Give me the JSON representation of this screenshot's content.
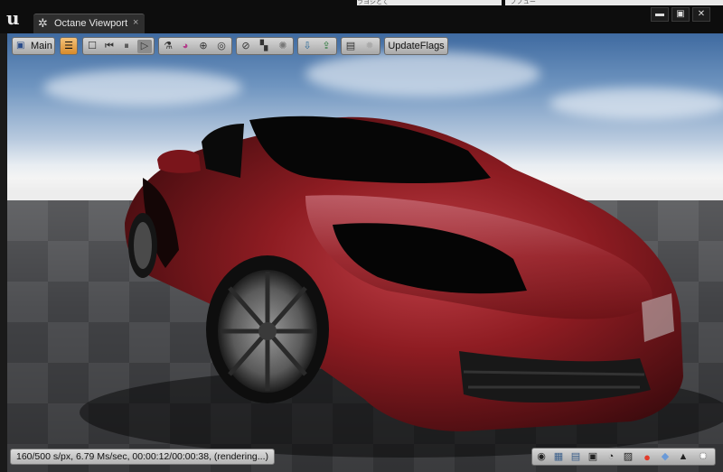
{
  "window": {
    "tab_title": "Octane Viewport",
    "tab_close": "×",
    "app_logo_glyph": "u",
    "minimize_glyph": "▬",
    "maximize_glyph": "▣",
    "close_glyph": "✕",
    "background_text_left": "ラヨシとて",
    "background_text_right": "ノノュー"
  },
  "toolbar": {
    "main_label": "Main",
    "update_flags_label": "UpdateFlags",
    "icons": [
      "settings-icon",
      "stop-icon",
      "restart-icon",
      "pause-icon",
      "play-icon",
      "material-picker-icon",
      "color-icon",
      "object-picker-icon",
      "focus-picker-icon",
      "region-icon",
      "checker-icon",
      "render-passes-icon",
      "import-icon",
      "export-icon",
      "save-image-icon",
      "sun-icon"
    ]
  },
  "status": {
    "text": "160/500 s/px, 6.79 Ms/sec, 00:00:12/00:00:38, (rendering...)"
  },
  "bottom_tools": {
    "icons": [
      "camera-icon",
      "render-target-icon",
      "film-icon",
      "image-icon",
      "clock-icon",
      "region-render-icon",
      "record-icon",
      "cube-icon",
      "picture-icon",
      "sun-icon"
    ],
    "record_color": "#e23b2b"
  },
  "colors": {
    "car_paint": "#8e1c22",
    "floor": "#4e4f52",
    "sky_top": "#3f6aa0",
    "toolbar_active": "#e9a64a"
  }
}
